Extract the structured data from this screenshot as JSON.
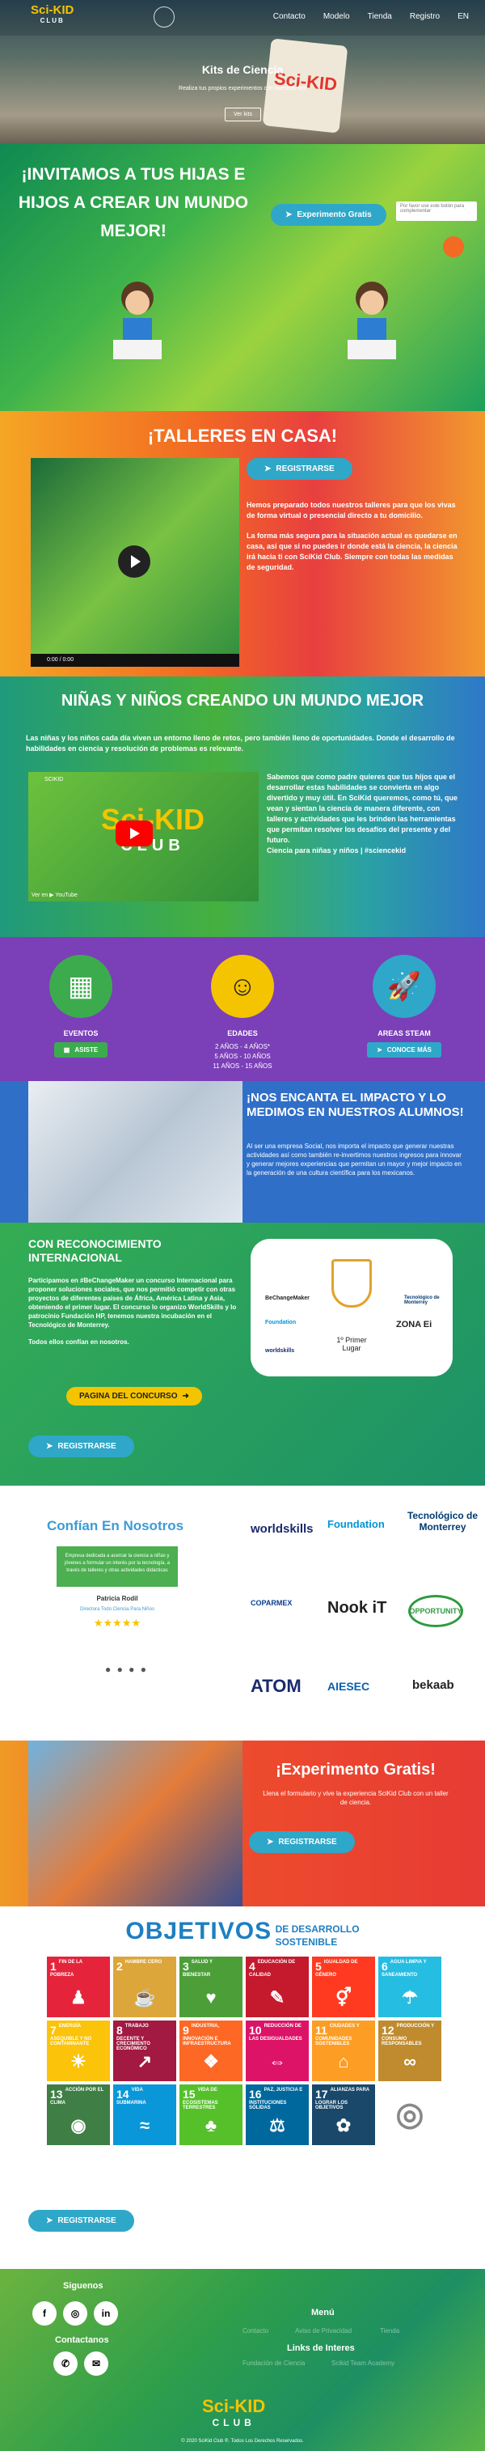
{
  "nav": {
    "logo_top": "Sci-KID",
    "logo_bottom": "CLUB",
    "links": [
      "Contacto",
      "Modelo",
      "Tienda",
      "Registro",
      "EN"
    ]
  },
  "hero": {
    "title": "Kits de Ciencia",
    "subtitle": "Realiza tus propios experimentos con nuestros kits",
    "button": "Ver kits",
    "sign": "Sci-KID"
  },
  "invite": {
    "title": "¡INVITAMOS A TUS HIJAS E HIJOS A CREAR UN MUNDO MEJOR!",
    "button": "Experimento Gratis",
    "popup": "Por favor use este botón para complementar"
  },
  "talleres": {
    "title": "¡TALLERES EN CASA!",
    "button": "REGISTRARSE",
    "video_time": "0:00 / 0:00",
    "p1": "Hemos preparado todos nuestros talleres para que los vivas de forma virtual o presencial directo a tu domicilio.",
    "p2": "La forma más segura para la situación actual es quedarse en casa, así que si no puedes ir donde está la ciencia, la ciencia irá hacia ti con SciKid Club. Siempre con todas las medidas de seguridad."
  },
  "ninas": {
    "title": "NIÑAS Y NIÑOS CREANDO UN MUNDO MEJOR",
    "subtitle": "Las niñas y los niños cada día viven un entorno lleno de retos, pero también lleno de oportunidades. Donde el desarrollo de habilidades en ciencia y resolución de problemas es relevante.",
    "video_channel": "SCIKID",
    "video_watch": "Ver en ▶ YouTube",
    "logo_top": "Sci-KID",
    "logo_bottom": "CLUB",
    "text": "Sabemos que como padre quieres que tus hijos que el desarrollar estas habilidades se convierta en algo divertido y muy útil. En SciKid queremos, como tú, que vean y sientan la ciencia de manera diferente, con talleres y actividades que les brinden las herramientas que permitan resolver los desafíos del presente y del futuro.",
    "tagline": "Ciencia para niñas y niños | #sciencekid"
  },
  "stats": {
    "eventos": {
      "label": "EVENTOS",
      "button": "ASISTE"
    },
    "edades": {
      "label": "EDADES",
      "lines": [
        "2 AÑOS - 4 AÑOS*",
        "5 AÑOS - 10 AÑOS",
        "11 AÑOS - 15 AÑOS"
      ]
    },
    "areas": {
      "label": "AREAS STEAM",
      "button": "CONOCE MÁS"
    }
  },
  "impacto": {
    "title": "¡NOS ENCANTA EL IMPACTO Y LO MEDIMOS EN NUESTROS ALUMNOS!",
    "text": "Al ser una empresa Social, nos importa el impacto que generar nuestras actividades así como también re-invertimos nuestros ingresos para innovar y generar mejores experiencias que permitan un mayor y mejor impacto en la generación de una cultura científica para los mexicanos."
  },
  "recon": {
    "title": "CON RECONOCIMIENTO INTERNACIONAL",
    "p1": "Participamos en #BeChangeMaker un concurso Internacional para proponer soluciones sociales, que nos permitió competir con otras proyectos de diferentes países de África, América Latina y Asia, obteniendo el primer lugar. El concurso lo organizo WorldSkills y lo patrocinio Fundación HP, tenemos nuestra incubación en el Tecnológico de Monterrey.",
    "p2": "Todos ellos confían en nosotros.",
    "contest_button": "PAGINA DEL CONCURSO",
    "button": "REGISTRARSE",
    "award": {
      "bcm": "BeChangeMaker",
      "hp": "Foundation",
      "tec": "Tecnológico de Monterrey",
      "ws": "worldskills",
      "zona": "ZONA Ei",
      "place": "1º Primer Lugar"
    }
  },
  "confian": {
    "title": "Confían En Nosotros",
    "quote": "Empresa dedicada a acercar la ciencia a niñas y jóvenes a formular un interés por la tecnología, a través de talleres y otras actividades didácticas",
    "name": "Patricia Rodil",
    "role": "Directora Todo Ciencia Para Niños",
    "stars": "★★★★★",
    "logos": {
      "ws": "worldskills",
      "hp": "Foundation",
      "tec": "Tecnológico de Monterrey",
      "coparmex": "COPARMEX",
      "nook": "Nook iT",
      "opp": "OPPORTUNITY",
      "atom": "ATOM",
      "aiesec": "AIESEC",
      "bekaab": "bekaab"
    }
  },
  "exper": {
    "title": "¡Experimento Gratis!",
    "subtitle": "Llena el formulario y vive la experiencia SciKid Club con un taller de ciencia.",
    "button": "REGISTRARSE"
  },
  "ods": {
    "big": "OBJETIVOS",
    "small1": "DE DESARROLLO",
    "small2": "SOSTENIBLE",
    "goals": [
      {
        "n": "1",
        "t": "FIN DE LA POBREZA",
        "c": "#e5243b",
        "g": "♟"
      },
      {
        "n": "2",
        "t": "HAMBRE CERO",
        "c": "#dda63a",
        "g": "☕"
      },
      {
        "n": "3",
        "t": "SALUD Y BIENESTAR",
        "c": "#4c9f38",
        "g": "♥"
      },
      {
        "n": "4",
        "t": "EDUCACIÓN DE CALIDAD",
        "c": "#c5192d",
        "g": "✎"
      },
      {
        "n": "5",
        "t": "IGUALDAD DE GÉNERO",
        "c": "#ff3a21",
        "g": "⚥"
      },
      {
        "n": "6",
        "t": "AGUA LIMPIA Y SANEAMIENTO",
        "c": "#26bde2",
        "g": "☂"
      },
      {
        "n": "7",
        "t": "ENERGÍA ASEQUIBLE Y NO CONTAMINANTE",
        "c": "#fcc30b",
        "g": "☀"
      },
      {
        "n": "8",
        "t": "TRABAJO DECENTE Y CRECIMIENTO ECONÓMICO",
        "c": "#a21942",
        "g": "↗"
      },
      {
        "n": "9",
        "t": "INDUSTRIA, INNOVACIÓN E INFRAESTRUCTURA",
        "c": "#fd6925",
        "g": "❖"
      },
      {
        "n": "10",
        "t": "REDUCCIÓN DE LAS DESIGUALDADES",
        "c": "#dd1367",
        "g": "⇔"
      },
      {
        "n": "11",
        "t": "CIUDADES Y COMUNIDADES SOSTENIBLES",
        "c": "#fd9d24",
        "g": "⌂"
      },
      {
        "n": "12",
        "t": "PRODUCCIÓN Y CONSUMO RESPONSABLES",
        "c": "#bf8b2e",
        "g": "∞"
      },
      {
        "n": "13",
        "t": "ACCIÓN POR EL CLIMA",
        "c": "#3f7e44",
        "g": "◉"
      },
      {
        "n": "14",
        "t": "VIDA SUBMARINA",
        "c": "#0a97d9",
        "g": "≈"
      },
      {
        "n": "15",
        "t": "VIDA DE ECOSISTEMAS TERRESTRES",
        "c": "#56c02b",
        "g": "♣"
      },
      {
        "n": "16",
        "t": "PAZ, JUSTICIA E INSTITUCIONES SÓLIDAS",
        "c": "#00689d",
        "g": "⚖"
      },
      {
        "n": "17",
        "t": "ALIANZAS PARA LOGRAR LOS OBJETIVOS",
        "c": "#19486a",
        "g": "✿"
      },
      {
        "n": "",
        "t": "",
        "c": "#ffffff",
        "g": "◎"
      }
    ]
  },
  "regbar": {
    "button": "REGISTRARSE"
  },
  "footer": {
    "siguenos": "Siguenos",
    "contactanos": "Contactanos",
    "menu": "Menú",
    "menu_links": [
      "Contacto",
      "Aviso de Privacidad",
      "Tienda"
    ],
    "links_title": "Links de Interes",
    "interest_links": [
      "Fundación de Ciencia",
      "Scikid Team Academy"
    ],
    "logo_top": "Sci-KID",
    "logo_bottom": "CLUB",
    "copy": "© 2020 SciKid Club ®. Todos Los Derechos Reservados."
  }
}
